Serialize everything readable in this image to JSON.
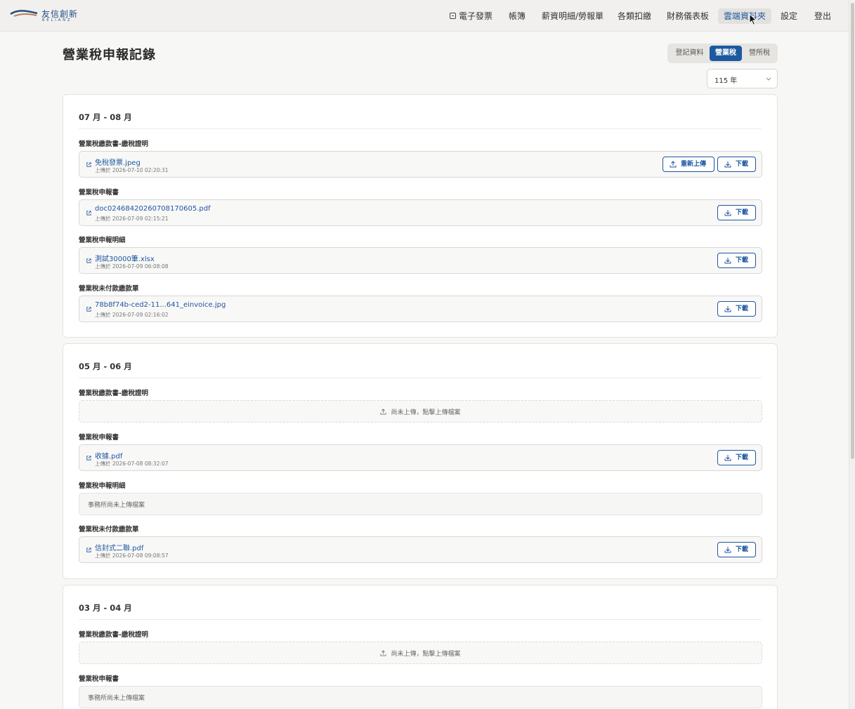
{
  "brand": {
    "name": "友信創新",
    "sub": "BELIANZ"
  },
  "nav": [
    {
      "label": "電子發票",
      "icon": "invoice-icon"
    },
    {
      "label": "帳簿"
    },
    {
      "label": "薪資明細/勞報單"
    },
    {
      "label": "各類扣繳"
    },
    {
      "label": "財務儀表板"
    },
    {
      "label": "雲端資料夾",
      "active": true
    },
    {
      "label": "設定"
    },
    {
      "label": "登出"
    }
  ],
  "page_title": "營業稅申報記錄",
  "tabs": [
    {
      "label": "登記資料"
    },
    {
      "label": "營業稅",
      "active": true
    },
    {
      "label": "營所稅"
    }
  ],
  "year_select": {
    "value": "115 年"
  },
  "buttons": {
    "download": "下載",
    "reupload": "重新上傳"
  },
  "periods": [
    {
      "title": "07 月 - 08 月",
      "sections": [
        {
          "label": "營業稅繳款書-繳稅證明",
          "state": "file",
          "file": "免稅發票.jpeg",
          "meta": "上傳於 2026-07-10 02:20:31",
          "reupload": true
        },
        {
          "label": "營業稅申報書",
          "state": "file",
          "file": "doc02468420260708170605.pdf",
          "meta": "上傳於 2026-07-09 02:15:21"
        },
        {
          "label": "營業稅申報明細",
          "state": "file",
          "file": "測試30000筆.xlsx",
          "meta": "上傳於 2026-07-09 06:08:08"
        },
        {
          "label": "營業稅未付款繳款單",
          "state": "file",
          "file": "78b8f74b-ced2-11...641_einvoice.jpg",
          "meta": "上傳於 2026-07-09 02:16:02"
        }
      ]
    },
    {
      "title": "05 月 - 06 月",
      "sections": [
        {
          "label": "營業稅繳款書-繳稅證明",
          "state": "upload",
          "text": "尚未上傳，點擊上傳檔案"
        },
        {
          "label": "營業稅申報書",
          "state": "file",
          "file": "收據.pdf",
          "meta": "上傳於 2026-07-08 08:32:07"
        },
        {
          "label": "營業稅申報明細",
          "state": "none",
          "text": "事務所尚未上傳檔案"
        },
        {
          "label": "營業稅未付款繳款單",
          "state": "file",
          "file": "信封式二聯.pdf",
          "meta": "上傳於 2026-07-08 09:08:57"
        }
      ]
    },
    {
      "title": "03 月 - 04 月",
      "sections": [
        {
          "label": "營業稅繳款書-繳稅證明",
          "state": "upload",
          "text": "尚未上傳，點擊上傳檔案"
        },
        {
          "label": "營業稅申報書",
          "state": "none",
          "text": "事務所尚未上傳檔案"
        }
      ]
    }
  ]
}
